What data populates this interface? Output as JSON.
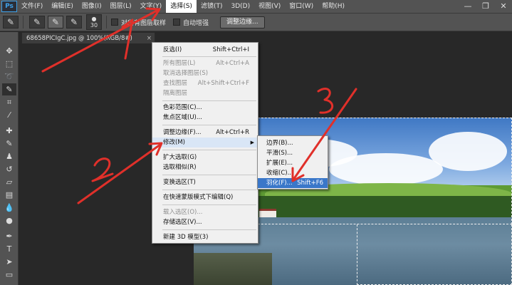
{
  "app": {
    "logo": "Ps"
  },
  "menubar": {
    "items": [
      "文件(F)",
      "编辑(E)",
      "图像(I)",
      "图层(L)",
      "文字(Y)",
      "选择(S)",
      "滤镜(T)",
      "3D(D)",
      "视图(V)",
      "窗口(W)",
      "帮助(H)"
    ],
    "active_index": 5,
    "window_controls": {
      "minimize": "—",
      "restore": "❐",
      "close": "✕"
    }
  },
  "optionsbar": {
    "brush_size": "30",
    "sample_all_layers_label": "对所有图层取样",
    "auto_enhance_label": "自动增强",
    "refine_edge_label": "调整边缘..."
  },
  "document": {
    "tab_title": "68658PICIgC.jpg @ 100%(RGB/8#)",
    "close": "×"
  },
  "select_menu": {
    "items": [
      {
        "label": "反选(I)",
        "shortcut": "Shift+Ctrl+I",
        "enabled": true
      },
      {
        "separator": true
      },
      {
        "label": "所有图层(L)",
        "shortcut": "Alt+Ctrl+A",
        "enabled": false
      },
      {
        "label": "取消选择图层(S)",
        "shortcut": "",
        "enabled": false
      },
      {
        "label": "查找图层",
        "shortcut": "Alt+Shift+Ctrl+F",
        "enabled": false
      },
      {
        "label": "隔离图层",
        "shortcut": "",
        "enabled": false
      },
      {
        "separator": true
      },
      {
        "label": "色彩范围(C)...",
        "shortcut": "",
        "enabled": true
      },
      {
        "label": "焦点区域(U)...",
        "shortcut": "",
        "enabled": true
      },
      {
        "separator": true
      },
      {
        "label": "调整边缘(F)...",
        "shortcut": "Alt+Ctrl+R",
        "enabled": true
      },
      {
        "label": "修改(M)",
        "shortcut": "",
        "enabled": true,
        "submenu": true,
        "hover": true
      },
      {
        "separator": true
      },
      {
        "label": "扩大选取(G)",
        "shortcut": "",
        "enabled": true
      },
      {
        "label": "选取相似(R)",
        "shortcut": "",
        "enabled": true
      },
      {
        "separator": true
      },
      {
        "label": "变换选区(T)",
        "shortcut": "",
        "enabled": true
      },
      {
        "separator": true
      },
      {
        "label": "在快速蒙版模式下编辑(Q)",
        "shortcut": "",
        "enabled": true
      },
      {
        "separator": true
      },
      {
        "label": "载入选区(O)...",
        "shortcut": "",
        "enabled": false
      },
      {
        "label": "存储选区(V)...",
        "shortcut": "",
        "enabled": true
      },
      {
        "separator": true
      },
      {
        "label": "新建 3D 模型(3)",
        "shortcut": "",
        "enabled": true
      }
    ]
  },
  "modify_submenu": {
    "items": [
      {
        "label": "边界(B)...",
        "shortcut": ""
      },
      {
        "label": "平滑(S)...",
        "shortcut": ""
      },
      {
        "label": "扩展(E)...",
        "shortcut": ""
      },
      {
        "label": "收缩(C)...",
        "shortcut": ""
      },
      {
        "label": "羽化(F)...",
        "shortcut": "Shift+F6",
        "highlighted": true
      }
    ]
  },
  "annotations": {
    "step1": "1",
    "step2": "2",
    "step3": "3",
    "color": "#e0302a"
  },
  "colors": {
    "ui_dark": "#535353",
    "canvas": "#282828",
    "menu_bg": "#f0f0f0",
    "highlight": "#3a77c9"
  }
}
